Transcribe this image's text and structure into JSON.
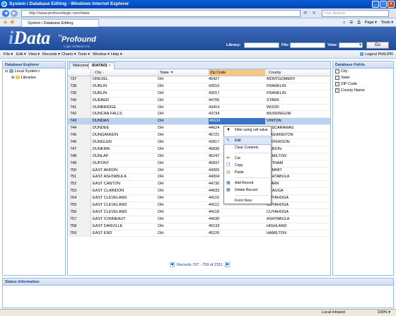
{
  "window": {
    "title": "System i Database Editing - Windows Internet Explorer"
  },
  "browser": {
    "url": "http://www.profoundlogic.com/idata",
    "search_placeholder": "Live Search",
    "tab_label": "System i Database Editing",
    "page_menu": "Page ▾",
    "tools_menu": "Tools ▾"
  },
  "header": {
    "logo_i": "i",
    "logo_data": "Data",
    "logo_by": "by",
    "logo_profound": "Profound",
    "logo_sub": "Logic Software Inc.",
    "library_label": "Library:",
    "file_label": "File:",
    "view_label": "View:",
    "go_label": "Go"
  },
  "menubar": {
    "items": [
      "File ▾",
      "Edit ▾",
      "View ▾",
      "Records ▾",
      "Charts ▾",
      "Tools ▾",
      "Window ▾",
      "Help ▾"
    ],
    "logout": "Logout PHILIPR"
  },
  "explorer": {
    "title": "Database Explorer",
    "root": "Local System i",
    "child": "Libraries"
  },
  "tabs": [
    "Welcome",
    "IDATA01"
  ],
  "grid": {
    "columns": [
      "",
      "City",
      "State",
      "Zip Code",
      "County"
    ],
    "rows": [
      [
        "737",
        "DREXEL",
        "OH",
        "45427",
        "MONTGOMERY"
      ],
      [
        "738",
        "DUBLIN",
        "OH",
        "43016",
        "FRANKLIN"
      ],
      [
        "739",
        "DUBLIN",
        "OH",
        "43017",
        "FRANKLIN"
      ],
      [
        "740",
        "DUEBER",
        "OH",
        "44706",
        "STARK"
      ],
      [
        "741",
        "DUNBRIDGE",
        "OH",
        "43414",
        "WOOD"
      ],
      [
        "742",
        "DUNCAN FALLS",
        "OH",
        "43734",
        "MUSKINGUM"
      ],
      [
        "743",
        "DUNDAS",
        "OH",
        "45634",
        "VINTON"
      ],
      [
        "744",
        "DUNDEE",
        "OH",
        "44624",
        "TUSCARAWAS"
      ],
      [
        "745",
        "DUNGANNON",
        "OH",
        "45721",
        "WASHINGTON"
      ],
      [
        "746",
        "DUNGLEN",
        "OH",
        "43917",
        "JEFFERSON"
      ],
      [
        "747",
        "DUNKIRK",
        "OH",
        "45836",
        "HARDIN"
      ],
      [
        "748",
        "DUNLAP",
        "OH",
        "45247",
        "HAMILTON"
      ],
      [
        "749",
        "DUPONT",
        "OH",
        "45837",
        "PUTNAM"
      ],
      [
        "750",
        "EAST AKRON",
        "OH",
        "44305",
        "SUMMIT"
      ],
      [
        "751",
        "EAST ASHTABULA",
        "OH",
        "44004",
        "ASHTABULA"
      ],
      [
        "752",
        "EAST CANTON",
        "OH",
        "44730",
        "STARK"
      ],
      [
        "753",
        "EAST CLARIDON",
        "OH",
        "44033",
        "GEAUGA"
      ],
      [
        "754",
        "EAST CLEVELAND",
        "OH",
        "44110",
        "CUYAHOGA"
      ],
      [
        "755",
        "EAST CLEVELAND",
        "OH",
        "44112",
        "CUYAHOGA"
      ],
      [
        "756",
        "EAST CLEVELAND",
        "OH",
        "44118",
        "CUYAHOGA"
      ],
      [
        "757",
        "EAST CONNEAUT",
        "OH",
        "44030",
        "ASHTABULA"
      ],
      [
        "758",
        "EAST DANVILLE",
        "OH",
        "45133",
        "HIGHLAND"
      ],
      [
        "759",
        "EAST END",
        "OH",
        "45226",
        "HAMILTON"
      ]
    ],
    "pager_text": "Records 737 - 759 of 2311"
  },
  "context_menu": {
    "items": [
      "Filter using cell value",
      "Edit",
      "Clear Contents",
      "Cut",
      "Copy",
      "Paste",
      "Add Record",
      "Delete Record",
      "Form View"
    ]
  },
  "fields": {
    "title": "Database Fields",
    "items": [
      "City",
      "State",
      "ZIP Code",
      "County Name"
    ]
  },
  "status": {
    "title": "Status Information",
    "zone": "Local intranet",
    "zoom": "100% ▾"
  },
  "colors": {
    "accent": "#3b74c4",
    "header_bg": "#1e4b9a",
    "sorted_column": "#f6c58a",
    "selected_row": "#bcd2ee"
  }
}
